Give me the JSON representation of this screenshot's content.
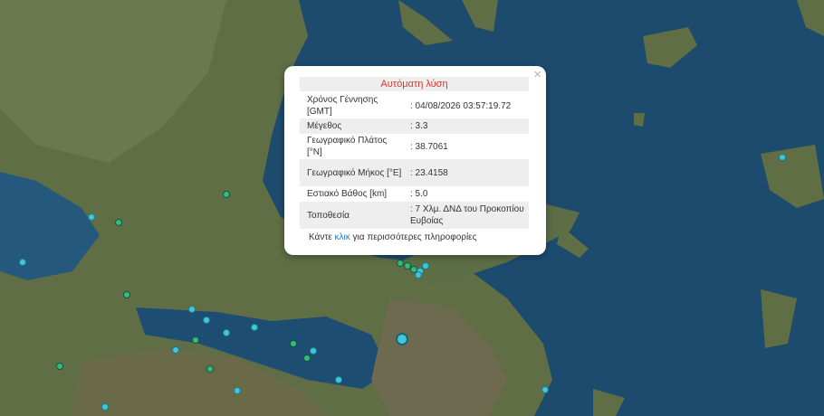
{
  "popup": {
    "title": "Αυτόματη λύση",
    "close_symbol": "×",
    "rows": [
      {
        "label": "Χρόνος Γέννησης [GMT]",
        "value": ": 04/08/2026 03:57:19.72"
      },
      {
        "label": "Μέγεθος",
        "value": ": 3.3"
      },
      {
        "label": "Γεωγραφικό Πλάτος [°N]",
        "value": ": 38.7061"
      },
      {
        "label": "Γεωγραφικό Μήκος [°E]",
        "value": ": 23.4158"
      },
      {
        "label": "Εστιακό Βάθος [km]",
        "value": ": 5.0"
      },
      {
        "label": "Τοποθεσία",
        "value": ": 7 Χλμ. ΔΝΔ του Προκοπίου Ευβοίας"
      }
    ],
    "more_prefix": "Κάντε",
    "more_link": "κλικ",
    "more_suffix": "για περισσότερες πληροφορίες"
  },
  "colors": {
    "sea": "#1d4b6e",
    "land": "#5f6e44",
    "quake_green": "#3cb878",
    "quake_cyan": "#45c6d8",
    "title_red": "#d9352e",
    "link_blue": "#2a7ac7"
  }
}
